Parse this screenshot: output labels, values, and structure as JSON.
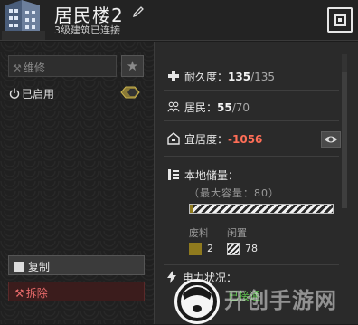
{
  "header": {
    "title": "居民楼2",
    "subtitle": "3级建筑已连接"
  },
  "left": {
    "repair_label": "维修",
    "enabled_label": "已启用",
    "copy_label": "复制",
    "demolish_label": "拆除"
  },
  "stats": {
    "durability_label": "耐久度：",
    "durability_value": "135",
    "durability_max": "/135",
    "residents_label": "居民：",
    "residents_value": "55",
    "residents_max": "/70",
    "livability_label": "宜居度：",
    "livability_value": "-1056"
  },
  "storage": {
    "label": "本地储量：",
    "capacity_text": "（最大容量：80）",
    "scrap_label": "废料",
    "scrap_value": "2",
    "idle_label": "闲置",
    "idle_value": "78",
    "scrap_fraction": 0.025,
    "scrap_color": "#8f7a1e"
  },
  "power": {
    "label": "电力状况：",
    "status": "已接通",
    "status_color": "#5ec24f"
  },
  "watermark": {
    "text": "开创手游网"
  }
}
